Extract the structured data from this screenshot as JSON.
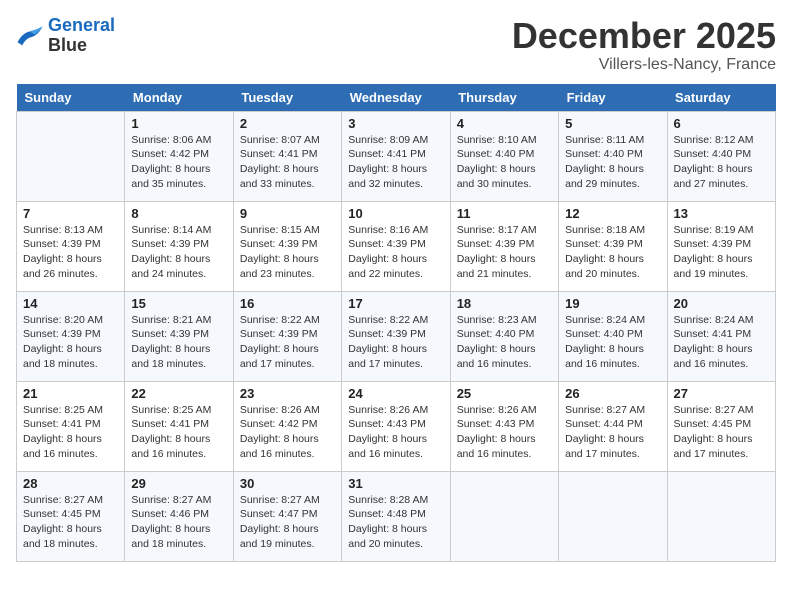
{
  "header": {
    "logo_line1": "General",
    "logo_line2": "Blue",
    "month": "December 2025",
    "location": "Villers-les-Nancy, France"
  },
  "weekdays": [
    "Sunday",
    "Monday",
    "Tuesday",
    "Wednesday",
    "Thursday",
    "Friday",
    "Saturday"
  ],
  "weeks": [
    [
      {
        "day": "",
        "sunrise": "",
        "sunset": "",
        "daylight": ""
      },
      {
        "day": "1",
        "sunrise": "Sunrise: 8:06 AM",
        "sunset": "Sunset: 4:42 PM",
        "daylight": "Daylight: 8 hours and 35 minutes."
      },
      {
        "day": "2",
        "sunrise": "Sunrise: 8:07 AM",
        "sunset": "Sunset: 4:41 PM",
        "daylight": "Daylight: 8 hours and 33 minutes."
      },
      {
        "day": "3",
        "sunrise": "Sunrise: 8:09 AM",
        "sunset": "Sunset: 4:41 PM",
        "daylight": "Daylight: 8 hours and 32 minutes."
      },
      {
        "day": "4",
        "sunrise": "Sunrise: 8:10 AM",
        "sunset": "Sunset: 4:40 PM",
        "daylight": "Daylight: 8 hours and 30 minutes."
      },
      {
        "day": "5",
        "sunrise": "Sunrise: 8:11 AM",
        "sunset": "Sunset: 4:40 PM",
        "daylight": "Daylight: 8 hours and 29 minutes."
      },
      {
        "day": "6",
        "sunrise": "Sunrise: 8:12 AM",
        "sunset": "Sunset: 4:40 PM",
        "daylight": "Daylight: 8 hours and 27 minutes."
      }
    ],
    [
      {
        "day": "7",
        "sunrise": "Sunrise: 8:13 AM",
        "sunset": "Sunset: 4:39 PM",
        "daylight": "Daylight: 8 hours and 26 minutes."
      },
      {
        "day": "8",
        "sunrise": "Sunrise: 8:14 AM",
        "sunset": "Sunset: 4:39 PM",
        "daylight": "Daylight: 8 hours and 24 minutes."
      },
      {
        "day": "9",
        "sunrise": "Sunrise: 8:15 AM",
        "sunset": "Sunset: 4:39 PM",
        "daylight": "Daylight: 8 hours and 23 minutes."
      },
      {
        "day": "10",
        "sunrise": "Sunrise: 8:16 AM",
        "sunset": "Sunset: 4:39 PM",
        "daylight": "Daylight: 8 hours and 22 minutes."
      },
      {
        "day": "11",
        "sunrise": "Sunrise: 8:17 AM",
        "sunset": "Sunset: 4:39 PM",
        "daylight": "Daylight: 8 hours and 21 minutes."
      },
      {
        "day": "12",
        "sunrise": "Sunrise: 8:18 AM",
        "sunset": "Sunset: 4:39 PM",
        "daylight": "Daylight: 8 hours and 20 minutes."
      },
      {
        "day": "13",
        "sunrise": "Sunrise: 8:19 AM",
        "sunset": "Sunset: 4:39 PM",
        "daylight": "Daylight: 8 hours and 19 minutes."
      }
    ],
    [
      {
        "day": "14",
        "sunrise": "Sunrise: 8:20 AM",
        "sunset": "Sunset: 4:39 PM",
        "daylight": "Daylight: 8 hours and 18 minutes."
      },
      {
        "day": "15",
        "sunrise": "Sunrise: 8:21 AM",
        "sunset": "Sunset: 4:39 PM",
        "daylight": "Daylight: 8 hours and 18 minutes."
      },
      {
        "day": "16",
        "sunrise": "Sunrise: 8:22 AM",
        "sunset": "Sunset: 4:39 PM",
        "daylight": "Daylight: 8 hours and 17 minutes."
      },
      {
        "day": "17",
        "sunrise": "Sunrise: 8:22 AM",
        "sunset": "Sunset: 4:39 PM",
        "daylight": "Daylight: 8 hours and 17 minutes."
      },
      {
        "day": "18",
        "sunrise": "Sunrise: 8:23 AM",
        "sunset": "Sunset: 4:40 PM",
        "daylight": "Daylight: 8 hours and 16 minutes."
      },
      {
        "day": "19",
        "sunrise": "Sunrise: 8:24 AM",
        "sunset": "Sunset: 4:40 PM",
        "daylight": "Daylight: 8 hours and 16 minutes."
      },
      {
        "day": "20",
        "sunrise": "Sunrise: 8:24 AM",
        "sunset": "Sunset: 4:41 PM",
        "daylight": "Daylight: 8 hours and 16 minutes."
      }
    ],
    [
      {
        "day": "21",
        "sunrise": "Sunrise: 8:25 AM",
        "sunset": "Sunset: 4:41 PM",
        "daylight": "Daylight: 8 hours and 16 minutes."
      },
      {
        "day": "22",
        "sunrise": "Sunrise: 8:25 AM",
        "sunset": "Sunset: 4:41 PM",
        "daylight": "Daylight: 8 hours and 16 minutes."
      },
      {
        "day": "23",
        "sunrise": "Sunrise: 8:26 AM",
        "sunset": "Sunset: 4:42 PM",
        "daylight": "Daylight: 8 hours and 16 minutes."
      },
      {
        "day": "24",
        "sunrise": "Sunrise: 8:26 AM",
        "sunset": "Sunset: 4:43 PM",
        "daylight": "Daylight: 8 hours and 16 minutes."
      },
      {
        "day": "25",
        "sunrise": "Sunrise: 8:26 AM",
        "sunset": "Sunset: 4:43 PM",
        "daylight": "Daylight: 8 hours and 16 minutes."
      },
      {
        "day": "26",
        "sunrise": "Sunrise: 8:27 AM",
        "sunset": "Sunset: 4:44 PM",
        "daylight": "Daylight: 8 hours and 17 minutes."
      },
      {
        "day": "27",
        "sunrise": "Sunrise: 8:27 AM",
        "sunset": "Sunset: 4:45 PM",
        "daylight": "Daylight: 8 hours and 17 minutes."
      }
    ],
    [
      {
        "day": "28",
        "sunrise": "Sunrise: 8:27 AM",
        "sunset": "Sunset: 4:45 PM",
        "daylight": "Daylight: 8 hours and 18 minutes."
      },
      {
        "day": "29",
        "sunrise": "Sunrise: 8:27 AM",
        "sunset": "Sunset: 4:46 PM",
        "daylight": "Daylight: 8 hours and 18 minutes."
      },
      {
        "day": "30",
        "sunrise": "Sunrise: 8:27 AM",
        "sunset": "Sunset: 4:47 PM",
        "daylight": "Daylight: 8 hours and 19 minutes."
      },
      {
        "day": "31",
        "sunrise": "Sunrise: 8:28 AM",
        "sunset": "Sunset: 4:48 PM",
        "daylight": "Daylight: 8 hours and 20 minutes."
      },
      {
        "day": "",
        "sunrise": "",
        "sunset": "",
        "daylight": ""
      },
      {
        "day": "",
        "sunrise": "",
        "sunset": "",
        "daylight": ""
      },
      {
        "day": "",
        "sunrise": "",
        "sunset": "",
        "daylight": ""
      }
    ]
  ]
}
